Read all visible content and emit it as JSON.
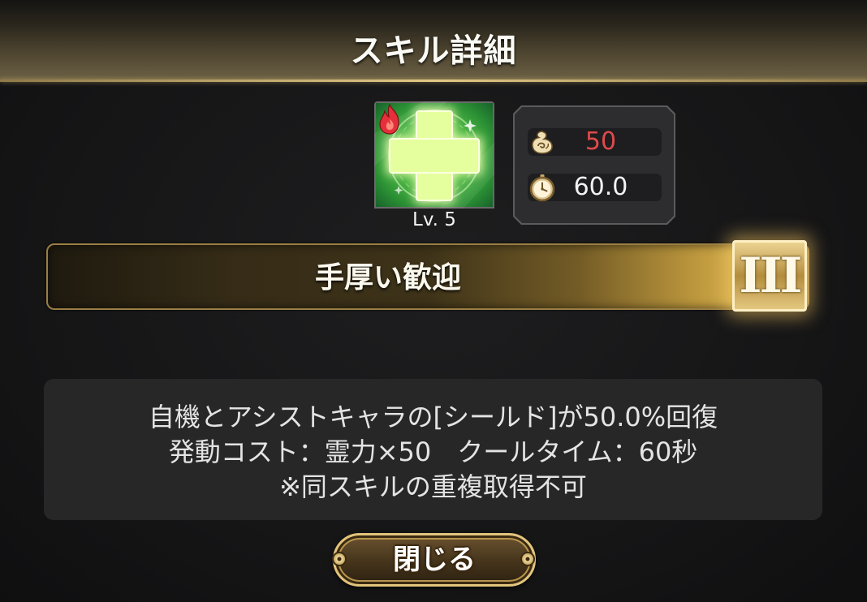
{
  "header": {
    "title": "スキル詳細"
  },
  "skill": {
    "level_label": "Lv. 5",
    "name": "手厚い歓迎",
    "rank": "III",
    "icon": "heal-cross-icon",
    "element_icon": "fire-icon"
  },
  "stats": {
    "cost": {
      "icon": "spirit-icon",
      "value": "50",
      "color": "#e04a4a"
    },
    "cooldown": {
      "icon": "clock-icon",
      "value": "60.0",
      "color": "#f2f2f2"
    }
  },
  "description": {
    "lines": [
      "自機とアシストキャラの[シールド]が50.0%回復",
      "発動コスト：霊力×50　クールタイム：60秒",
      "※同スキルの重複取得不可"
    ]
  },
  "buttons": {
    "close_label": "閉じる"
  },
  "colors": {
    "accent_gold": "#d9bb72",
    "background": "#151516",
    "panel": "#272728"
  }
}
